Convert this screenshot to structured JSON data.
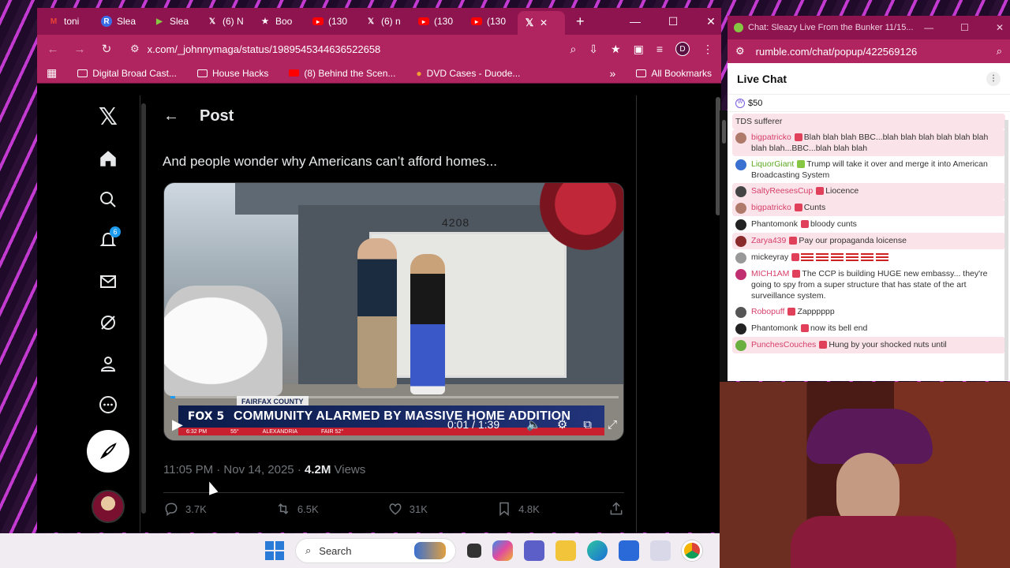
{
  "browser": {
    "tabs": [
      {
        "label": "toni",
        "icon": "gmail-icon",
        "color": "#ea4335"
      },
      {
        "label": "Slea",
        "icon": "r-icon",
        "color": "#3a6ee8"
      },
      {
        "label": "Slea",
        "icon": "rumble-icon",
        "color": "#85c742"
      },
      {
        "label": "(6) N",
        "icon": "x-icon",
        "color": "#000000"
      },
      {
        "label": "Boo",
        "icon": "star-icon",
        "color": "#ffffff"
      },
      {
        "label": "(130",
        "icon": "youtube-icon",
        "color": "#ff0000"
      },
      {
        "label": "(6) n",
        "icon": "x-icon",
        "color": "#000000"
      },
      {
        "label": "(130",
        "icon": "youtube-icon",
        "color": "#ff0000"
      },
      {
        "label": "(130",
        "icon": "youtube-icon",
        "color": "#ff0000"
      }
    ],
    "active_tab_close": "✕",
    "url": "x.com/_johnnymaga/status/1989545344636522658",
    "profile_initial": "D",
    "bookmarks": [
      {
        "label": "Digital Broad Cast...",
        "icon": "folder-icon"
      },
      {
        "label": "House Hacks",
        "icon": "folder-icon"
      },
      {
        "label": "(8) Behind the Scen...",
        "icon": "youtube-icon"
      },
      {
        "label": "DVD Cases - Duode...",
        "icon": "duolingo-icon"
      }
    ],
    "all_bookmarks": "All Bookmarks"
  },
  "x": {
    "notifications_badge": "6",
    "header_title": "Post",
    "tweet_text": "And people wonder why Americans can’t afford homes...",
    "video": {
      "house_number": "4208",
      "county_tag": "FAIRFAX COUNTY",
      "network": "FOX 5",
      "headline": "COMMUNITY ALARMED BY MASSIVE HOME ADDITION",
      "ticker_time": "6:32 PM",
      "ticker_temp": "55°",
      "ticker_place": "ALEXANDRIA",
      "ticker_fair": "FAIR 52°",
      "time": "0:01 / 1:39",
      "progress": 0.01
    },
    "meta": {
      "timestamp": "11:05 PM · Nov 14, 2025",
      "dot": " · ",
      "views_count": "4.2M",
      "views_label": " Views"
    },
    "actions": {
      "replies": "3.7K",
      "reposts": "6.5K",
      "likes": "31K",
      "bookmarks": "4.8K"
    }
  },
  "chat_window": {
    "title": "Chat: Sleazy Live From the Bunker 11/15...",
    "url": "rumble.com/chat/popup/422569126",
    "heading": "Live Chat",
    "rant_amount": "$50",
    "messages": [
      {
        "user": "",
        "text": "TDS sufferer",
        "hl": true,
        "user_class": "",
        "avatar_color": "#fbe3ea"
      },
      {
        "user": "bigpatricko",
        "text": "Blah blah blah BBC...blah blah blah blah blah blah blah blah...BBC...blah blah blah",
        "hl": true,
        "user_class": "",
        "avatar_color": "#b07a6a"
      },
      {
        "user": "LiquorGiant",
        "text": "Trump will take it over and merge it into American Broadcasting System",
        "hl": false,
        "user_class": "g",
        "avatar_color": "#3a70d0"
      },
      {
        "user": "SaltyReesesCup",
        "text": "Liocence",
        "hl": true,
        "user_class": "",
        "avatar_color": "#444444"
      },
      {
        "user": "bigpatricko",
        "text": "Cunts",
        "hl": true,
        "user_class": "",
        "avatar_color": "#b07a6a"
      },
      {
        "user": "Phantomonk",
        "text": "bloody cunts",
        "hl": false,
        "user_class": "dk",
        "avatar_color": "#222222"
      },
      {
        "user": "Zarya439",
        "text": "Pay our propaganda loicense",
        "hl": true,
        "user_class": "",
        "avatar_color": "#8a2a2a"
      },
      {
        "user": "mickeyray",
        "text": "",
        "hl": false,
        "user_class": "dk",
        "avatar_color": "#999999",
        "flags": true
      },
      {
        "user": "MICH1AM",
        "text": "The CCP is building HUGE new embassy... they're going to spy from a super structure that has state of the art surveillance system.",
        "hl": false,
        "user_class": "",
        "avatar_color": "#c03070"
      },
      {
        "user": "Robopuff",
        "text": "Zapppppp",
        "hl": false,
        "user_class": "",
        "avatar_color": "#555555"
      },
      {
        "user": "Phantomonk",
        "text": "now its bell end",
        "hl": false,
        "user_class": "dk",
        "avatar_color": "#222222"
      },
      {
        "user": "PunchesCouches",
        "text": "Hung by your shocked nuts until",
        "hl": true,
        "user_class": "",
        "avatar_color": "#6ab040"
      }
    ]
  },
  "taskbar": {
    "search_label": "Search"
  }
}
